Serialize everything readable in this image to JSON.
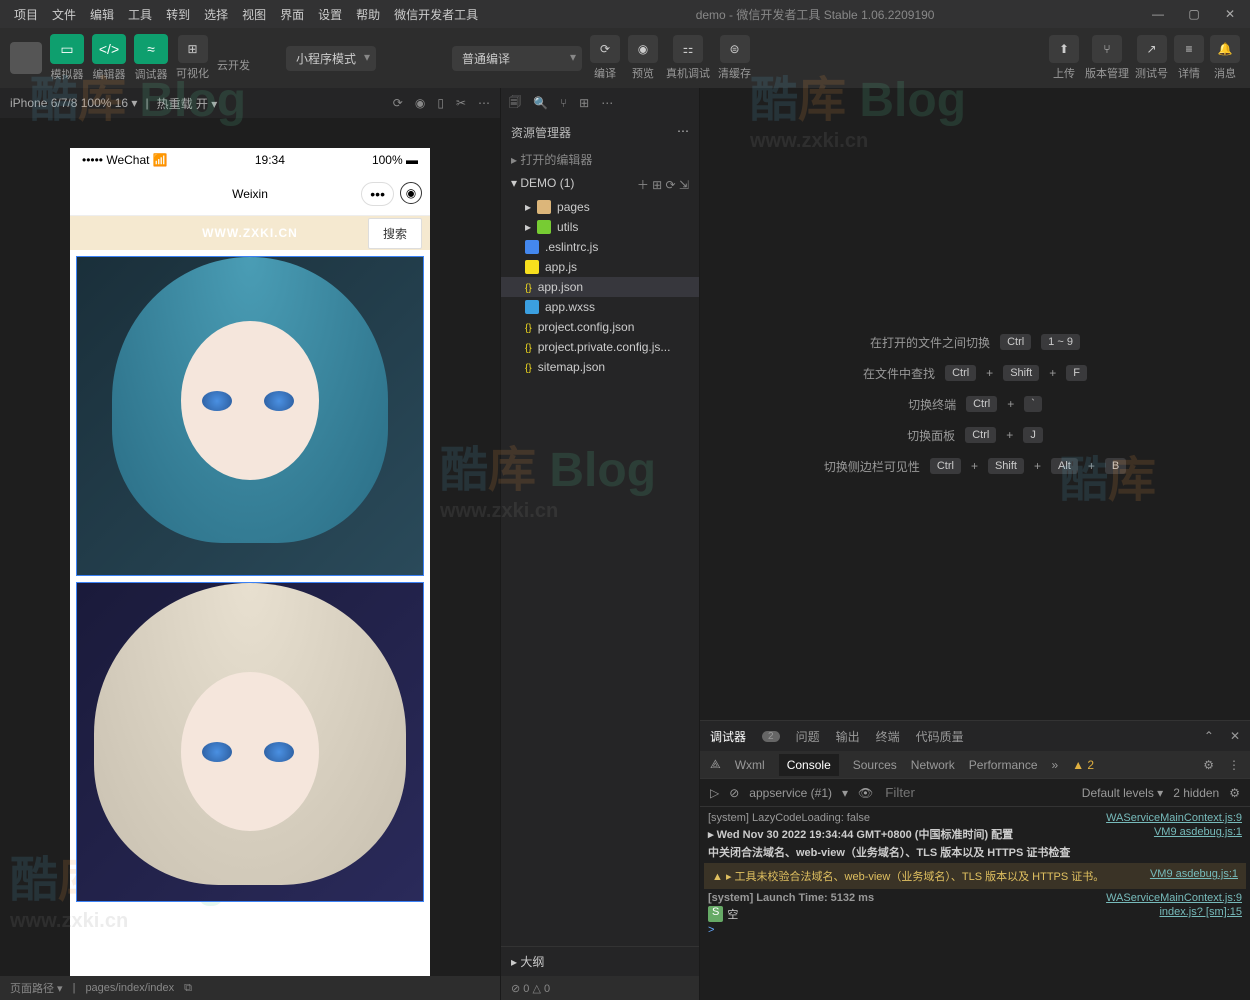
{
  "window": {
    "title": "demo - 微信开发者工具 Stable 1.06.2209190"
  },
  "menu": [
    "项目",
    "文件",
    "编辑",
    "工具",
    "转到",
    "选择",
    "视图",
    "界面",
    "设置",
    "帮助",
    "微信开发者工具"
  ],
  "toolbar": {
    "simulator": "模拟器",
    "editor": "编辑器",
    "debugger": "调试器",
    "visual": "可视化",
    "cloud": "云开发",
    "mode": "小程序模式",
    "compile": "普通编译",
    "compile_btn": "编译",
    "preview": "预览",
    "remote": "真机调试",
    "clear_cache": "清缓存",
    "upload": "上传",
    "version": "版本管理",
    "test": "测试号",
    "detail": "详情",
    "msg": "消息"
  },
  "sim": {
    "device": "iPhone 6/7/8 100% 16 ▾",
    "hot": "热重载 开 ▾"
  },
  "phone": {
    "carrier": "••••• WeChat",
    "time": "19:34",
    "battery": "100%",
    "title": "Weixin",
    "watermark": "WWW.ZXKI.CN",
    "search": "搜索"
  },
  "explorer": {
    "title": "资源管理器",
    "opened": "打开的编辑器",
    "project": "DEMO (1)",
    "files": [
      "pages",
      "utils",
      ".eslintrc.js",
      "app.js",
      "app.json",
      "app.wxss",
      "project.config.json",
      "project.private.config.js...",
      "sitemap.json"
    ],
    "outline": "大纲"
  },
  "shortcuts": [
    {
      "label": "在打开的文件之间切换",
      "keys": [
        "Ctrl",
        "1 ~ 9"
      ]
    },
    {
      "label": "在文件中查找",
      "keys": [
        "Ctrl",
        "+",
        "Shift",
        "+",
        "F"
      ]
    },
    {
      "label": "切换终端",
      "keys": [
        "Ctrl",
        "+",
        "`"
      ]
    },
    {
      "label": "切换面板",
      "keys": [
        "Ctrl",
        "+",
        "J"
      ]
    },
    {
      "label": "切换侧边栏可见性",
      "keys": [
        "Ctrl",
        "+",
        "Shift",
        "+",
        "Alt",
        "+",
        "B"
      ]
    }
  ],
  "debug": {
    "tabs": [
      "调试器",
      "问题",
      "输出",
      "终端",
      "代码质量"
    ],
    "badge": "2",
    "subtabs": [
      "Wxml",
      "Console",
      "Sources",
      "Network",
      "Performance"
    ],
    "warn_count": "2",
    "context": "appservice (#1)",
    "filter_ph": "Filter",
    "levels": "Default levels ▾",
    "hidden": "2 hidden",
    "lines": [
      {
        "msg": "[system] LazyCodeLoading: false",
        "src": "WAServiceMainContext.js:9",
        "cls": "sys"
      },
      {
        "msg": "▸ Wed Nov 30 2022 19:34:44 GMT+0800 (中国标准时间) 配置",
        "src": "VM9 asdebug.js:1"
      },
      {
        "msg": "中关闭合法域名、web-view（业务域名）、TLS 版本以及 HTTPS 证书检查",
        "src": ""
      },
      {
        "msg": "▲ ▸ 工具未校验合法域名、web-view（业务域名）、TLS 版本以及 HTTPS 证书。",
        "src": "VM9 asdebug.js:1",
        "cls": "warn"
      },
      {
        "msg": "[system] Launch Time: 5132 ms",
        "src": "WAServiceMainContext.js:9",
        "cls": "sys"
      },
      {
        "msg": "空",
        "src": "index.js? [sm]:15",
        "cls": "s"
      }
    ],
    "prompt": ">"
  },
  "status": {
    "path_label": "页面路径 ▾",
    "path": "pages/index/index",
    "errs": "⊘ 0 △ 0"
  },
  "wm": {
    "brand1": "酷",
    "brand2": "库",
    "blog": "Blog",
    "url": "www.zxki.cn"
  }
}
